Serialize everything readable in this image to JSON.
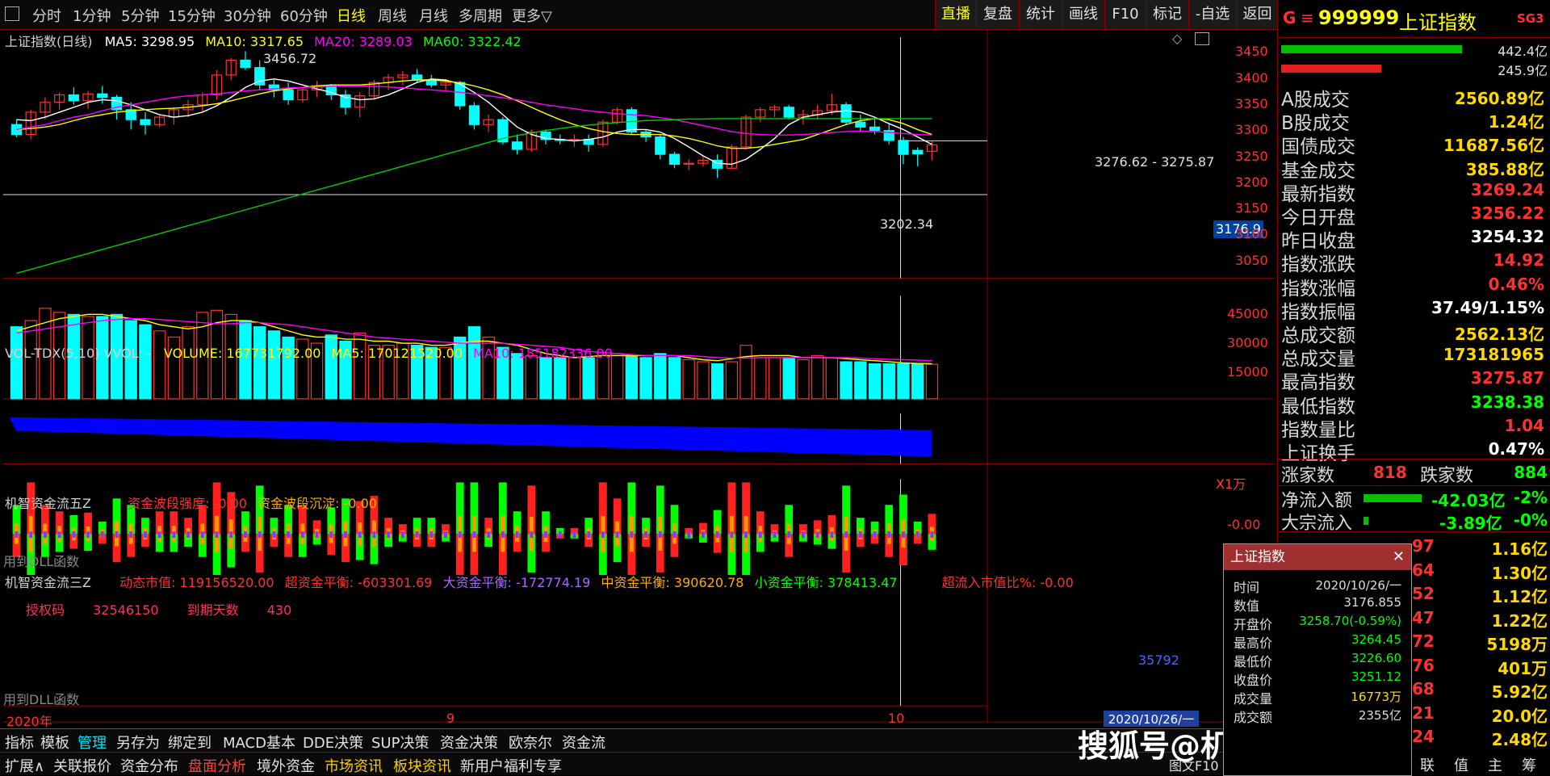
{
  "toolbar": {
    "periods": [
      "分时",
      "1分钟",
      "5分钟",
      "15分钟",
      "30分钟",
      "60分钟",
      "日线",
      "周线",
      "月线",
      "多周期",
      "更多▽"
    ],
    "active_period": "日线",
    "right_buttons": [
      "直播",
      "复盘",
      "统计",
      "画线",
      "F10",
      "标记",
      "-自选",
      "返回"
    ]
  },
  "kline": {
    "title": "上证指数(日线)",
    "ma5": "MA5: 3298.95",
    "ma10": "MA10: 3317.65",
    "ma20": "MA20: 3289.03",
    "ma60": "MA60: 3322.42",
    "yticks": [
      "3450",
      "3400",
      "3350",
      "3300",
      "3250",
      "3200",
      "3150",
      "3100",
      "3050"
    ],
    "high_label": "3456.72",
    "low_label": "3202.34",
    "cursor_label": "3276.62 - 3275.87",
    "cursor_price": "3176.9"
  },
  "vol": {
    "title": "VOL-TDX(5,10)  VVOL: -",
    "volume": "VOLUME: 167731792.00",
    "ma5": "MA5: 170121520.00",
    "ma10": "MA10: 185182336.00",
    "yticks": [
      "45000",
      "30000",
      "15000"
    ],
    "unit": "X1万"
  },
  "flow5": {
    "title": "机智资金流五Z",
    "f1": "资金波段强度: -0.00",
    "f2": "资金波段沉淀: -0.00",
    "ytick": "-0.00",
    "dll": "用到DLL函数"
  },
  "flow3": {
    "title": "机智资金流三Z",
    "f1": "动态市值: 119156520.00",
    "f2": "超资金平衡: -603301.69",
    "f3": "大资金平衡: -172774.19",
    "f4": "中资金平衡: 390620.78",
    "f5": "小资金平衡: 378413.47",
    "f6": "超流入市值比%: -0.00",
    "auth": "授权码",
    "auth_code": "32546150",
    "expire": "到期天数",
    "expire_days": "430",
    "last": "35792",
    "dll": "用到DLL函数"
  },
  "xaxis": {
    "year": "2020年",
    "m9": "9",
    "m10": "10",
    "cursor_date": "2020/10/26/一"
  },
  "info": {
    "code": "999999",
    "name": "上证指数",
    "badge": "SG3",
    "bar1_val": "442.4亿",
    "bar2_val": "245.9亿",
    "rows": [
      {
        "k": "A股成交",
        "v": "2560.89亿",
        "c": ""
      },
      {
        "k": "B股成交",
        "v": "1.24亿",
        "c": ""
      },
      {
        "k": "国债成交",
        "v": "11687.56亿",
        "c": ""
      },
      {
        "k": "基金成交",
        "v": "385.88亿",
        "c": ""
      },
      {
        "k": "最新指数",
        "v": "3269.24",
        "c": "red"
      },
      {
        "k": "今日开盘",
        "v": "3256.22",
        "c": "red"
      },
      {
        "k": "昨日收盘",
        "v": "3254.32",
        "c": "white"
      },
      {
        "k": "指数涨跌",
        "v": "14.92",
        "c": "red"
      },
      {
        "k": "指数涨幅",
        "v": "0.46%",
        "c": "red"
      },
      {
        "k": "指数振幅",
        "v": "37.49/1.15%",
        "c": "white"
      },
      {
        "k": "总成交额",
        "v": "2562.13亿",
        "c": ""
      },
      {
        "k": "总成交量",
        "v": "173181965",
        "c": ""
      },
      {
        "k": "最高指数",
        "v": "3275.87",
        "c": "red"
      },
      {
        "k": "最低指数",
        "v": "3238.38",
        "c": "green"
      },
      {
        "k": "指数量比",
        "v": "1.04",
        "c": "red"
      },
      {
        "k": "上证换手",
        "v": "0.47%",
        "c": "white"
      }
    ],
    "up_label": "涨家数",
    "up": "818",
    "down_label": "跌家数",
    "down": "884",
    "net_label": "净流入额",
    "net": "-42.03亿",
    "net_pct": "-2%",
    "big_label": "大宗流入",
    "big": "-3.89亿",
    "big_pct": "-0%",
    "list_left": [
      "97",
      "64",
      "52",
      "47",
      "72",
      "76",
      "68",
      "21",
      "24"
    ],
    "list_right": [
      "1.16亿",
      "1.30亿",
      "1.12亿",
      "1.22亿",
      "5198万",
      "401万",
      "5.92亿",
      "20.0亿",
      "2.48亿"
    ],
    "bottom_tabs": [
      "联",
      "值",
      "主",
      "筹"
    ]
  },
  "popup": {
    "title": "上证指数",
    "rows": [
      {
        "k": "时间",
        "v": "2020/10/26/一"
      },
      {
        "k": "数值",
        "v": "3176.855"
      },
      {
        "k": "开盘价",
        "v": "3258.70(-0.59%)"
      },
      {
        "k": "最高价",
        "v": "3264.45"
      },
      {
        "k": "最低价",
        "v": "3226.60"
      },
      {
        "k": "收盘价",
        "v": "3251.12"
      },
      {
        "k": "成交量",
        "v": "16773万"
      },
      {
        "k": "成交额",
        "v": "2355亿"
      }
    ]
  },
  "bottom1": [
    "指标",
    "模板",
    "管理",
    "另存为",
    "绑定到",
    "MACD基本",
    "DDE决策",
    "SUP决策",
    "资金决策",
    "欧奈尔",
    "资金流"
  ],
  "bottom2": [
    "扩展∧",
    "关联报价",
    "资金分布",
    "盘面分析",
    "境外资金",
    "市场资讯",
    "板块资讯",
    "新用户福利专享"
  ],
  "bottom_right": "图文F10",
  "watermark": "搜狐号@机智股票自动交易软件",
  "chart_data": {
    "type": "candlestick",
    "ohlc": [
      [
        3310,
        3320,
        3285,
        3290
      ],
      [
        3290,
        3340,
        3280,
        3335
      ],
      [
        3335,
        3365,
        3320,
        3355
      ],
      [
        3355,
        3375,
        3340,
        3370
      ],
      [
        3370,
        3385,
        3350,
        3358
      ],
      [
        3358,
        3378,
        3342,
        3372
      ],
      [
        3372,
        3388,
        3352,
        3365
      ],
      [
        3365,
        3370,
        3320,
        3340
      ],
      [
        3340,
        3355,
        3300,
        3320
      ],
      [
        3320,
        3335,
        3290,
        3310
      ],
      [
        3310,
        3330,
        3305,
        3325
      ],
      [
        3325,
        3345,
        3310,
        3340
      ],
      [
        3340,
        3360,
        3325,
        3350
      ],
      [
        3350,
        3375,
        3335,
        3370
      ],
      [
        3370,
        3420,
        3360,
        3410
      ],
      [
        3410,
        3445,
        3400,
        3440
      ],
      [
        3440,
        3458,
        3420,
        3425
      ],
      [
        3425,
        3440,
        3380,
        3390
      ],
      [
        3390,
        3400,
        3365,
        3380
      ],
      [
        3380,
        3395,
        3350,
        3360
      ],
      [
        3360,
        3385,
        3355,
        3380
      ],
      [
        3380,
        3398,
        3365,
        3388
      ],
      [
        3388,
        3392,
        3360,
        3370
      ],
      [
        3370,
        3380,
        3330,
        3345
      ],
      [
        3345,
        3375,
        3325,
        3368
      ],
      [
        3368,
        3400,
        3360,
        3395
      ],
      [
        3395,
        3412,
        3380,
        3405
      ],
      [
        3405,
        3418,
        3390,
        3410
      ],
      [
        3410,
        3422,
        3395,
        3400
      ],
      [
        3400,
        3410,
        3385,
        3390
      ],
      [
        3390,
        3402,
        3380,
        3395
      ],
      [
        3395,
        3398,
        3340,
        3348
      ],
      [
        3348,
        3355,
        3300,
        3310
      ],
      [
        3310,
        3330,
        3295,
        3320
      ],
      [
        3320,
        3325,
        3270,
        3275
      ],
      [
        3275,
        3290,
        3250,
        3260
      ],
      [
        3260,
        3300,
        3255,
        3295
      ],
      [
        3295,
        3300,
        3270,
        3280
      ],
      [
        3280,
        3290,
        3270,
        3278
      ],
      [
        3278,
        3290,
        3265,
        3280
      ],
      [
        3280,
        3290,
        3255,
        3270
      ],
      [
        3270,
        3320,
        3265,
        3315
      ],
      [
        3315,
        3345,
        3310,
        3340
      ],
      [
        3340,
        3345,
        3290,
        3295
      ],
      [
        3295,
        3300,
        3275,
        3285
      ],
      [
        3285,
        3290,
        3240,
        3250
      ],
      [
        3250,
        3255,
        3222,
        3230
      ],
      [
        3230,
        3240,
        3218,
        3232
      ],
      [
        3232,
        3245,
        3225,
        3238
      ],
      [
        3238,
        3250,
        3202,
        3222
      ],
      [
        3222,
        3270,
        3220,
        3265
      ],
      [
        3265,
        3330,
        3260,
        3325
      ],
      [
        3325,
        3345,
        3315,
        3340
      ],
      [
        3340,
        3350,
        3325,
        3345
      ],
      [
        3345,
        3350,
        3320,
        3325
      ],
      [
        3325,
        3340,
        3310,
        3330
      ],
      [
        3330,
        3350,
        3320,
        3338
      ],
      [
        3338,
        3372,
        3330,
        3350
      ],
      [
        3350,
        3355,
        3310,
        3315
      ],
      [
        3315,
        3330,
        3295,
        3305
      ],
      [
        3305,
        3320,
        3290,
        3298
      ],
      [
        3298,
        3312,
        3270,
        3278
      ],
      [
        3278,
        3285,
        3230,
        3250
      ],
      [
        3258,
        3264,
        3226,
        3251
      ],
      [
        3256,
        3276,
        3238,
        3269
      ]
    ],
    "ma5": [
      3320,
      3318,
      3325,
      3335,
      3345,
      3355,
      3360,
      3358,
      3350,
      3340,
      3330,
      3325,
      3328,
      3335,
      3348,
      3365,
      3385,
      3398,
      3402,
      3398,
      3390,
      3382,
      3375,
      3365,
      3360,
      3362,
      3370,
      3382,
      3395,
      3402,
      3400,
      3392,
      3375,
      3355,
      3330,
      3305,
      3290,
      3282,
      3280,
      3277,
      3280,
      3285,
      3295,
      3300,
      3300,
      3295,
      3282,
      3265,
      3247,
      3232,
      3230,
      3240,
      3260,
      3282,
      3310,
      3325,
      3330,
      3335,
      3338,
      3335,
      3325,
      3312,
      3300,
      3285,
      3270
    ],
    "ma10": [
      3300,
      3302,
      3305,
      3310,
      3318,
      3325,
      3330,
      3335,
      3338,
      3340,
      3342,
      3343,
      3345,
      3348,
      3352,
      3358,
      3365,
      3372,
      3378,
      3382,
      3385,
      3388,
      3390,
      3390,
      3390,
      3392,
      3395,
      3398,
      3400,
      3400,
      3398,
      3394,
      3388,
      3380,
      3370,
      3358,
      3345,
      3332,
      3320,
      3310,
      3302,
      3296,
      3292,
      3290,
      3290,
      3290,
      3287,
      3282,
      3275,
      3267,
      3262,
      3262,
      3265,
      3270,
      3275,
      3280,
      3290,
      3300,
      3310,
      3318,
      3322,
      3320,
      3312,
      3300,
      3290
    ],
    "ma20": [
      3300,
      3305,
      3310,
      3318,
      3325,
      3330,
      3338,
      3345,
      3350,
      3355,
      3360,
      3365,
      3368,
      3370,
      3372,
      3375,
      3378,
      3380,
      3382,
      3384,
      3385,
      3386,
      3387,
      3388,
      3388,
      3387,
      3386,
      3384,
      3382,
      3380,
      3378,
      3375,
      3372,
      3368,
      3364,
      3360,
      3355,
      3350,
      3346,
      3342,
      3338,
      3335,
      3332,
      3330,
      3328,
      3324,
      3320,
      3314,
      3308,
      3302,
      3296,
      3292,
      3290,
      3289,
      3289,
      3290,
      3292,
      3294,
      3296,
      3297,
      3296,
      3294,
      3292,
      3290,
      3289
    ],
    "ma60": [
      3010,
      3018,
      3026,
      3034,
      3042,
      3050,
      3058,
      3066,
      3074,
      3082,
      3090,
      3098,
      3106,
      3114,
      3122,
      3130,
      3138,
      3146,
      3154,
      3162,
      3170,
      3178,
      3186,
      3194,
      3202,
      3210,
      3218,
      3226,
      3234,
      3242,
      3250,
      3258,
      3266,
      3274,
      3282,
      3288,
      3293,
      3298,
      3302,
      3306,
      3309,
      3312,
      3314,
      3316,
      3318,
      3319,
      3320,
      3321,
      3321,
      3322,
      3322,
      3322,
      3322,
      3322,
      3322,
      3322,
      3322,
      3322,
      3322,
      3322,
      3322,
      3322,
      3322,
      3322,
      3322
    ],
    "volume": [
      35000,
      38000,
      44000,
      42000,
      41000,
      40000,
      40000,
      41000,
      38000,
      36000,
      33000,
      30000,
      35000,
      42000,
      43000,
      41000,
      38000,
      35000,
      33000,
      30000,
      29000,
      27000,
      31000,
      28000,
      32000,
      26000,
      26000,
      27000,
      26000,
      25000,
      25000,
      30000,
      35000,
      30000,
      25000,
      22000,
      21000,
      20000,
      20000,
      20000,
      20000,
      21000,
      22000,
      21000,
      20000,
      22000,
      20000,
      19000,
      18000,
      17000,
      18000,
      26000,
      20000,
      20000,
      20000,
      19000,
      21000,
      20000,
      18000,
      18000,
      17000,
      17000,
      17000,
      17000,
      16773
    ],
    "vol_ma5": [
      33000,
      35000,
      37000,
      39000,
      40000,
      41000,
      41000,
      40000,
      39000,
      38000,
      36000,
      35000,
      34000,
      35000,
      37000,
      38000,
      38000,
      37000,
      35000,
      33000,
      31000,
      30000,
      30000,
      29000,
      29000,
      28000,
      28000,
      27000,
      27000,
      26000,
      26000,
      27000,
      28000,
      28000,
      27000,
      26000,
      24000,
      22000,
      21000,
      20000,
      20500,
      21000,
      21000,
      21000,
      21000,
      21000,
      21000,
      20000,
      19000,
      18500,
      19500,
      20500,
      21000,
      21000,
      21000,
      20000,
      20000,
      20000,
      19500,
      19000,
      18500,
      18000,
      17500,
      17200,
      17012
    ],
    "vol_ma10": [
      32000,
      33000,
      34000,
      35000,
      36000,
      37000,
      38000,
      38500,
      39000,
      39000,
      38500,
      38000,
      37500,
      37000,
      36500,
      36500,
      37000,
      37000,
      36500,
      36000,
      35000,
      34000,
      33000,
      32000,
      31000,
      30000,
      29500,
      29000,
      28500,
      28000,
      27500,
      27000,
      27000,
      27000,
      27000,
      26500,
      26000,
      25500,
      25000,
      24000,
      23000,
      22500,
      22000,
      21500,
      21000,
      21000,
      21000,
      21000,
      20500,
      20000,
      19800,
      19800,
      20000,
      20000,
      20000,
      20000,
      20000,
      20000,
      20000,
      19800,
      19500,
      19200,
      19000,
      18800,
      18518
    ],
    "ylim": [
      3000,
      3480
    ],
    "vol_ylim": [
      0,
      50000
    ]
  }
}
